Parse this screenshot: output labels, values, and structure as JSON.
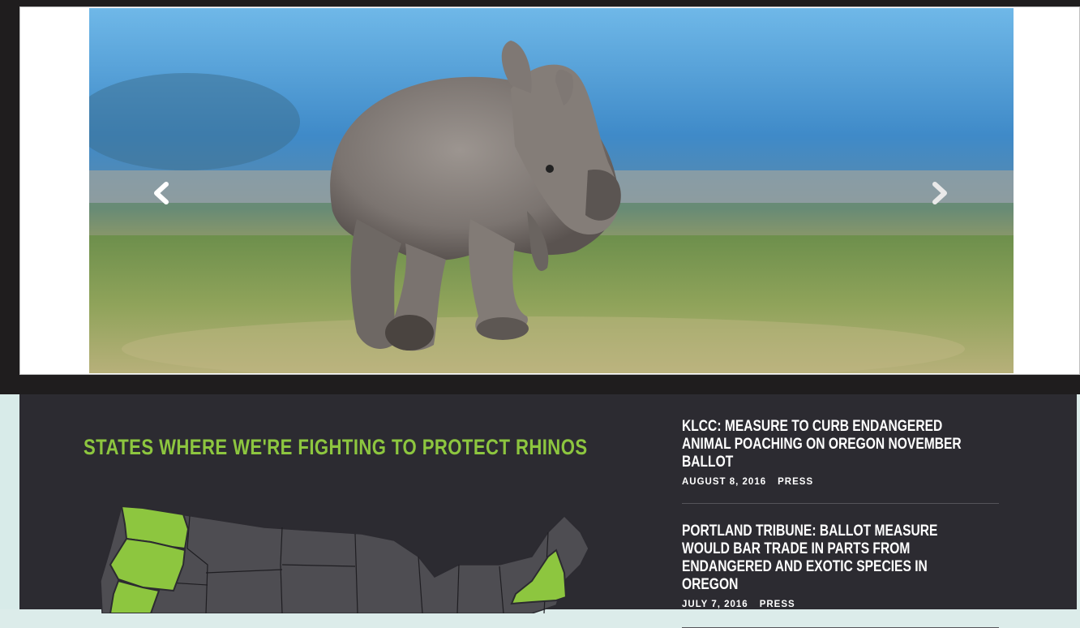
{
  "slider": {
    "image_alt": "Baby rhino running across a grassy savanna",
    "prev_icon": "chevron-left-icon",
    "next_icon": "chevron-right-icon"
  },
  "map_section": {
    "title": "STATES WHERE WE'RE FIGHTING TO PROTECT RHINOS",
    "highlighted_states": [
      "Washington",
      "Oregon",
      "California",
      "New York"
    ],
    "highlight_color": "#8dc63f",
    "state_color": "#4e4d52"
  },
  "news": [
    {
      "title": "KLCC: MEASURE TO CURB ENDANGERED ANIMAL POACHING ON OREGON NOVEMBER BALLOT",
      "date": "AUGUST 8, 2016",
      "category": "PRESS"
    },
    {
      "title": "PORTLAND TRIBUNE: BALLOT MEASURE WOULD BAR TRADE IN PARTS FROM ENDANGERED AND EXOTIC SPECIES IN OREGON",
      "date": "JULY 7, 2016",
      "category": "PRESS"
    }
  ],
  "colors": {
    "accent": "#8dc63f",
    "dark_band": "#1f1d1e",
    "content_bg": "#2c2b31"
  }
}
